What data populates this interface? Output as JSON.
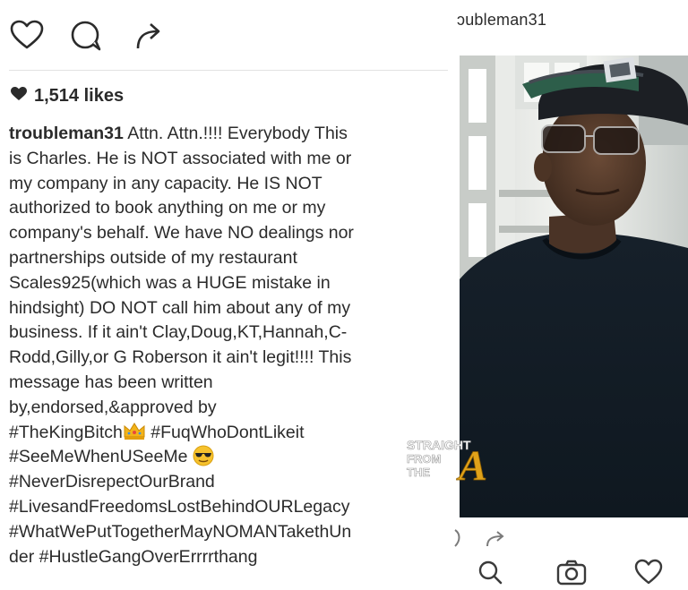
{
  "left_post": {
    "likes_text": "1,514 likes",
    "caption": {
      "username": "troubleman31",
      "lines": [
        " Attn. Attn.!!!! Everybody This",
        "is Charles. He is NOT associated with me or",
        "my company in any capacity. He IS NOT",
        "authorized to book anything on me or my",
        "company's behalf. We have NO dealings nor",
        "partnerships outside of my restaurant",
        "Scales925(which was a HUGE mistake in",
        "hindsight) DO NOT call him about any of my",
        "business. If it ain't Clay,Doug,KT,Hannah,C-",
        "Rodd,Gilly,or G Roberson it ain't legit!!!! This",
        "message has been written",
        "by,endorsed,&approved by"
      ],
      "hashtag_king": "#TheKingBitch",
      "hashtag_fuq": "#FuqWhoDontLikeit",
      "hashtag_seeme": "#SeeMeWhenUSeeMe",
      "hashtag_never": "#NeverDisrepectOurBrand",
      "hashtag_lives": "#LivesandFreedomsLostBehindOURLegacy",
      "hashtag_what": "#WhatWePutTogetherMayNOMANTakethUn",
      "line_last_prefix": "der ",
      "hashtag_hustle": "#HustleGangOverErrrrthang"
    }
  },
  "right_post": {
    "username": "ɔubleman31"
  },
  "watermark": {
    "line1": "STRAIGHT",
    "line2": "FROM",
    "line3": "THE",
    "letter": "A"
  },
  "icons": {
    "left_like": "heart-outline-icon",
    "left_comment": "comment-bubble-icon",
    "left_share": "share-arrow-icon",
    "likes_heart": "heart-filled-icon",
    "right_search": "search-icon",
    "right_camera": "camera-icon",
    "right_heart": "heart-outline-icon"
  },
  "colors": {
    "text": "#2b2b2b",
    "divider": "#e2e2e2",
    "watermark_gold": "#e0a21a"
  }
}
